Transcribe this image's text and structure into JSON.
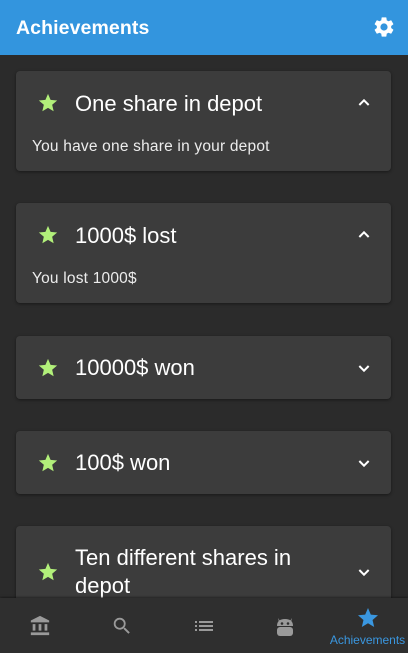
{
  "app": {
    "title": "Achievements",
    "accent": "#3395de",
    "star_color": "#b2f07a"
  },
  "header": {
    "settings_icon": "gear-icon"
  },
  "achievements": [
    {
      "title": "One share in depot",
      "description": "You have one share in your depot",
      "expanded": true
    },
    {
      "title": "1000$ lost",
      "description": "You lost 1000$",
      "expanded": true
    },
    {
      "title": "10000$ won",
      "description": "",
      "expanded": false
    },
    {
      "title": "100$ won",
      "description": "",
      "expanded": false
    },
    {
      "title_line1": "Ten different shares in",
      "title_line2": "depot",
      "description": "",
      "expanded": false
    }
  ],
  "bottom_nav": {
    "items": [
      {
        "icon": "bank-icon",
        "label": ""
      },
      {
        "icon": "search-icon",
        "label": ""
      },
      {
        "icon": "list-icon",
        "label": ""
      },
      {
        "icon": "android-icon",
        "label": ""
      },
      {
        "icon": "star-icon",
        "label": "Achievements",
        "selected": true
      }
    ]
  }
}
